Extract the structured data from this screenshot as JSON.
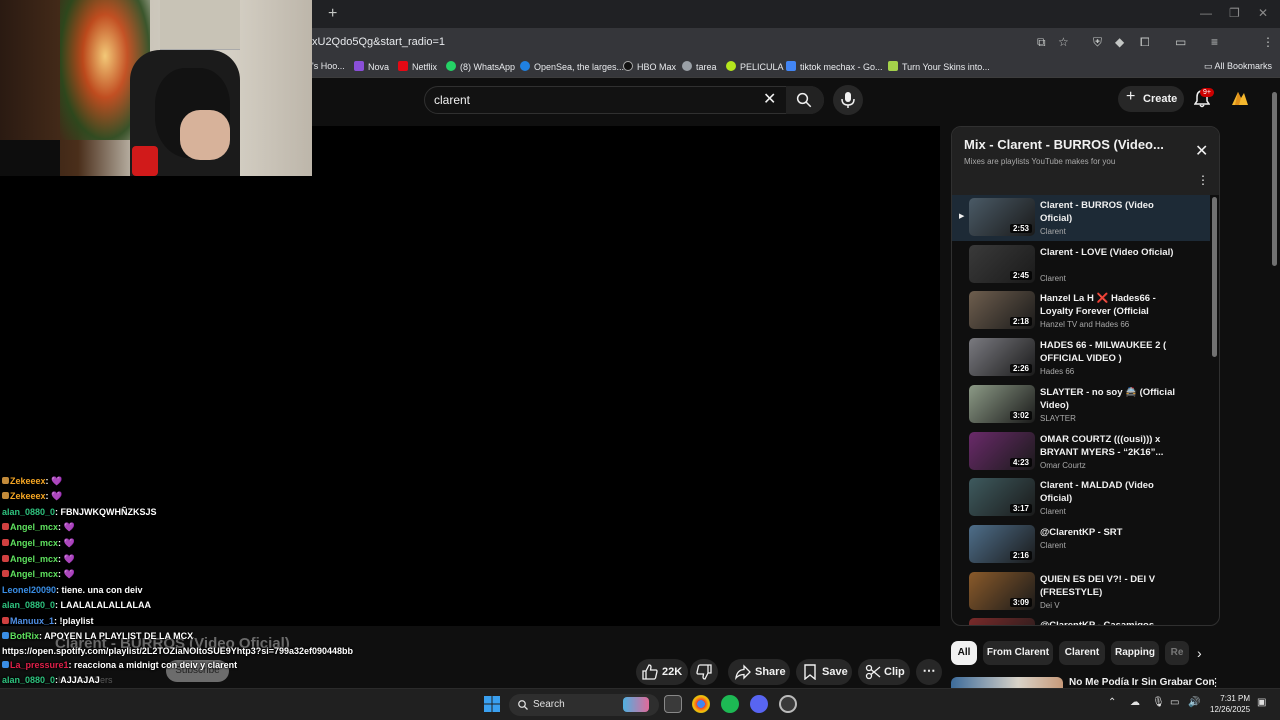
{
  "browser": {
    "url": "xU2Qdo5Qg&start_radio=1",
    "profile_initial": "M",
    "bookmarks": [
      {
        "label": "'s Hoo...",
        "color": "#3c3c3c"
      },
      {
        "label": "Nova",
        "color": "#8a4fd8"
      },
      {
        "label": "Netflix",
        "color": "#e50914"
      },
      {
        "label": "(8) WhatsApp",
        "color": "#25d366"
      },
      {
        "label": "OpenSea, the larges...",
        "color": "#2081e2"
      },
      {
        "label": "HBO Max",
        "color": "#111111"
      },
      {
        "label": "tarea",
        "color": "#9aa0a6"
      },
      {
        "label": "PELICULA",
        "color": "#b5e61d"
      },
      {
        "label": "tiktok mechax - Go...",
        "color": "#4285f4"
      },
      {
        "label": "Turn Your Skins into...",
        "color": "#a4d24a"
      }
    ],
    "all_bookmarks": "All Bookmarks"
  },
  "header": {
    "search_value": "clarent",
    "create_label": "Create",
    "notif_badge": "9+"
  },
  "video": {
    "title": "Clarent - BURROS (Video Oficial)",
    "subs": "K subscribers",
    "subscribe_label": "Subscribe",
    "likes": "22K",
    "share_label": "Share",
    "save_label": "Save",
    "clip_label": "Clip"
  },
  "chat": [
    {
      "user": "Zekeeex",
      "msg": ": 💜",
      "color": "#f5a623",
      "badge": "#c28a3a"
    },
    {
      "user": "Zekeeex",
      "msg": ": 💜",
      "color": "#f5a623",
      "badge": "#c28a3a"
    },
    {
      "user": "alan_0880_0",
      "msg": ": FBNJWKQWHÑZKSJS",
      "color": "#2ec27e",
      "badge": ""
    },
    {
      "user": "Angel_mcx",
      "msg": ": 💜",
      "color": "#5ee05e",
      "badge": "#d04040"
    },
    {
      "user": "Angel_mcx",
      "msg": ": 💜",
      "color": "#5ee05e",
      "badge": "#d04040"
    },
    {
      "user": "Angel_mcx",
      "msg": ": 💜",
      "color": "#5ee05e",
      "badge": "#d04040"
    },
    {
      "user": "Angel_mcx",
      "msg": ": 💜",
      "color": "#5ee05e",
      "badge": "#d04040"
    },
    {
      "user": "Leonel20090",
      "msg": ": tiene. una con deiv",
      "color": "#3a8ee6",
      "badge": ""
    },
    {
      "user": "alan_0880_0",
      "msg": ": LAALALALALLALAA",
      "color": "#2ec27e",
      "badge": ""
    },
    {
      "user": "Manuux_1",
      "msg": ": !playlist",
      "color": "#4f8fe6",
      "badge": "#d04040"
    },
    {
      "user": "BotRix",
      "msg": ": APOYEN LA PLAYLIST DE LA MCX",
      "color": "#5ee05e",
      "badge": "#3a8ee6"
    },
    {
      "user": "",
      "msg": "https://open.spotify.com/playlist/2L2TOZiaNOltoSUE9Yhtp3?si=799a32ef090448bb",
      "color": "#ffffff",
      "badge": ""
    },
    {
      "user": "La_pressure1",
      "msg": ": reacciona a midnigt con deiv y clarent",
      "color": "#e0204a",
      "badge": "#3a8ee6"
    },
    {
      "user": "alan_0880_0",
      "msg": ": AJJAJAJ",
      "color": "#2ec27e",
      "badge": ""
    },
    {
      "user": "JoseSauce_00",
      "msg": ": dise mi mamá que me va a dejar ver pero va estar biendo",
      "color": "#c0203a",
      "badge": ""
    },
    {
      "user": "alan_0880_0",
      "msg": ": JJAJAAJ",
      "color": "#2ec27e",
      "badge": ""
    }
  ],
  "playlist": {
    "title": "Mix - Clarent - BURROS (Video...",
    "subtitle": "Mixes are playlists YouTube makes for you",
    "items": [
      {
        "title": "Clarent - BURROS (Video Oficial)",
        "channel": "Clarent",
        "duration": "2:53",
        "thumb": "#4a5a66"
      },
      {
        "title": "Clarent - LOVE (Video Oficial)",
        "channel": "Clarent",
        "duration": "2:45",
        "thumb": "#3a3a3a"
      },
      {
        "title": "Hanzel La H ❌ Hades66 - Loyalty Forever (Official Video)",
        "channel": "Hanzel TV and Hades 66",
        "duration": "2:18",
        "thumb": "#6e5e4e"
      },
      {
        "title": "HADES 66 - MILWAUKEE 2 ( OFFICIAL VIDEO )",
        "channel": "Hades 66",
        "duration": "2:26",
        "thumb": "#7a7a80"
      },
      {
        "title": "SLAYTER - no soy 🚔 (Official Video)",
        "channel": "SLAYTER",
        "duration": "3:02",
        "thumb": "#8c9a86"
      },
      {
        "title": "OMAR COURTZ (((ousi))) x BRYANT MYERS - “2K16”...",
        "channel": "Omar Courtz",
        "duration": "4:23",
        "thumb": "#6a2a6a"
      },
      {
        "title": "Clarent - MALDAD (Video Oficial)",
        "channel": "Clarent",
        "duration": "3:17",
        "thumb": "#3e5a5e"
      },
      {
        "title": "@ClarentKP - SRT",
        "channel": "Clarent",
        "duration": "2:16",
        "thumb": "#4e6e8a"
      },
      {
        "title": "QUIEN ES DEI V?! - DEI V (FREESTYLE)",
        "channel": "Dei V",
        "duration": "3:09",
        "thumb": "#8a5a2a"
      },
      {
        "title": "@ClarentKP - Casamigos",
        "channel": "",
        "duration": "",
        "thumb": "#7a2a2a"
      }
    ]
  },
  "chips": [
    "All",
    "From Clarent",
    "Clarent",
    "Rapping",
    "Re"
  ],
  "recommendation": {
    "title": "No Me Podía Ir Sin Grabar Con"
  },
  "taskbar": {
    "search_label": "Search",
    "time": "7:31 PM",
    "date": "12/26/2025"
  }
}
